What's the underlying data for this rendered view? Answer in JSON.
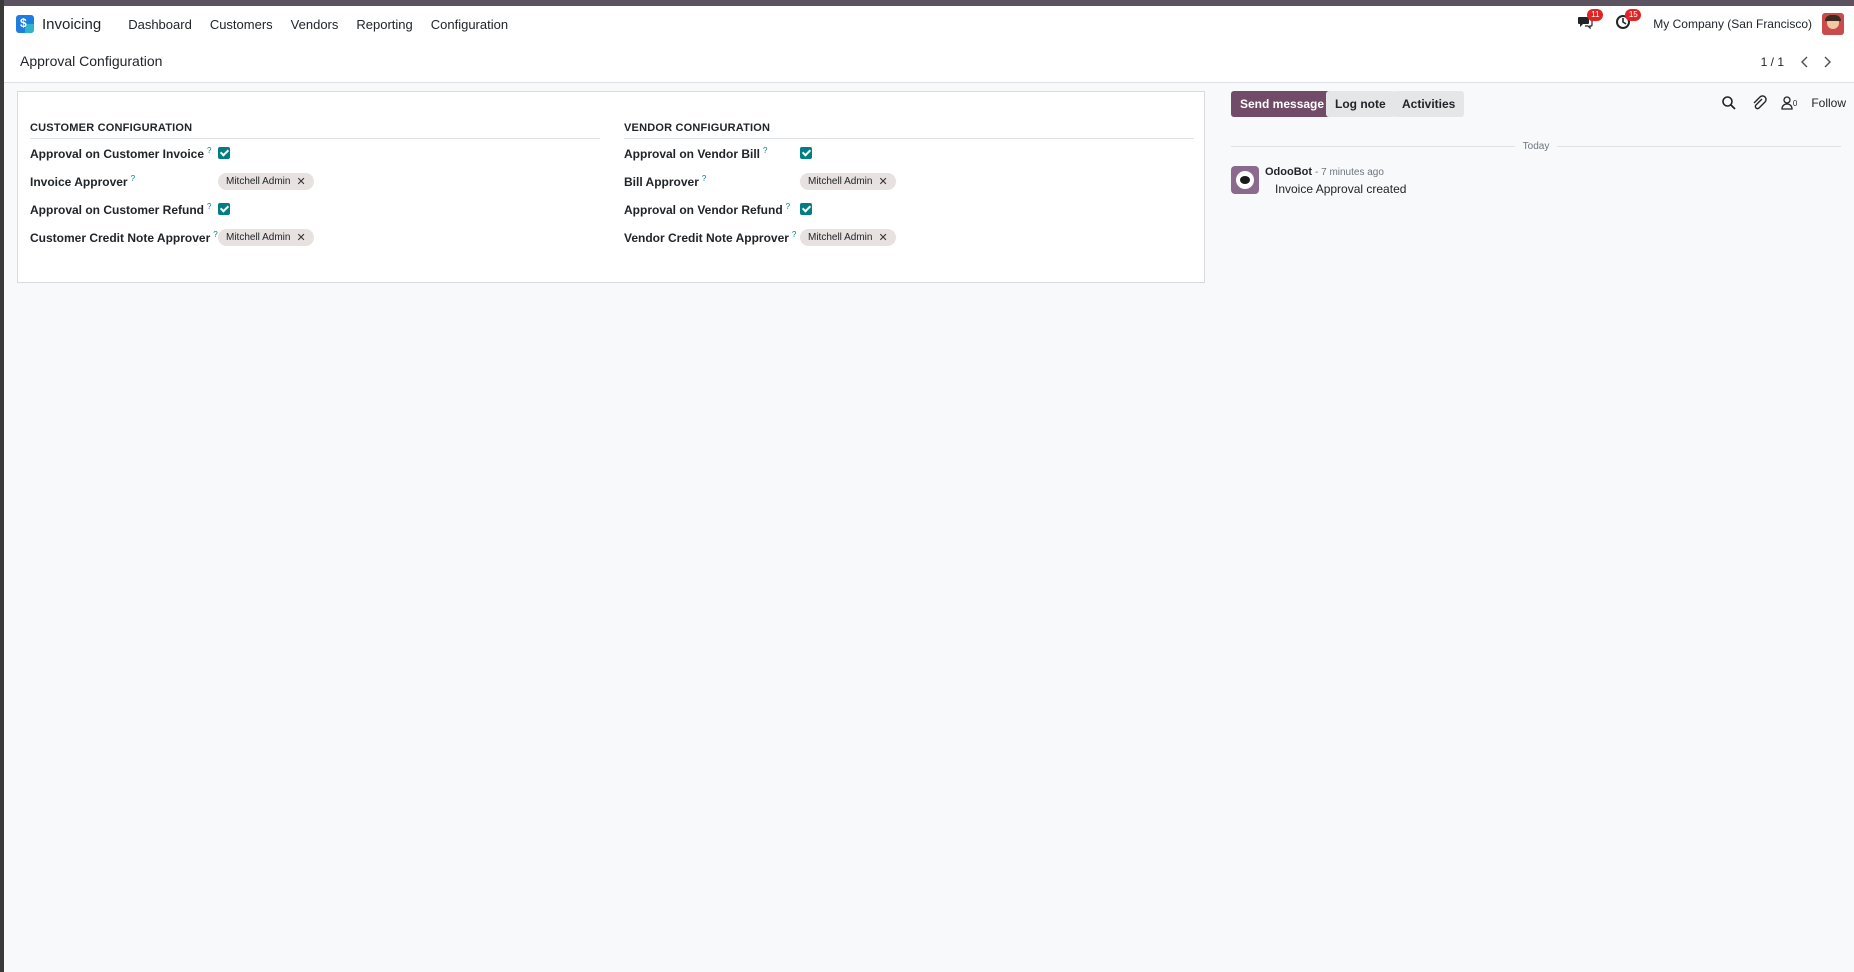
{
  "navbar": {
    "app_name": "Invoicing",
    "menu": [
      "Dashboard",
      "Customers",
      "Vendors",
      "Reporting",
      "Configuration"
    ],
    "messages_badge": "11",
    "activities_badge": "15",
    "company": "My Company (San Francisco)"
  },
  "control_panel": {
    "title": "Approval Configuration",
    "pager": "1 / 1"
  },
  "form": {
    "customer": {
      "title": "CUSTOMER CONFIGURATION",
      "fields": [
        {
          "label": "Approval on Customer Invoice",
          "help": "?",
          "type": "checkbox",
          "checked": true
        },
        {
          "label": "Invoice Approver",
          "help": "?",
          "type": "tag",
          "value": "Mitchell Admin"
        },
        {
          "label": "Approval on Customer Refund",
          "help": "?",
          "type": "checkbox",
          "checked": true
        },
        {
          "label": "Customer Credit Note Approver",
          "help": "?",
          "type": "tag",
          "value": "Mitchell Admin"
        }
      ]
    },
    "vendor": {
      "title": "VENDOR CONFIGURATION",
      "fields": [
        {
          "label": "Approval on Vendor Bill",
          "help": "?",
          "type": "checkbox",
          "checked": true
        },
        {
          "label": "Bill Approver",
          "help": "?",
          "type": "tag",
          "value": "Mitchell Admin"
        },
        {
          "label": "Approval on Vendor Refund",
          "help": "?",
          "type": "checkbox",
          "checked": true
        },
        {
          "label": "Vendor Credit Note Approver",
          "help": "?",
          "type": "tag",
          "value": "Mitchell Admin"
        }
      ]
    }
  },
  "chatter": {
    "send_message": "Send message",
    "log_note": "Log note",
    "activities": "Activities",
    "follower_count": "0",
    "follow": "Follow",
    "date_separator": "Today",
    "messages": [
      {
        "author": "OdooBot",
        "time": "- 7 minutes ago",
        "body": "Invoice Approval created"
      }
    ]
  },
  "colors": {
    "primary": "#714b67",
    "checkbox": "#017e84",
    "badge": "#e02424"
  }
}
